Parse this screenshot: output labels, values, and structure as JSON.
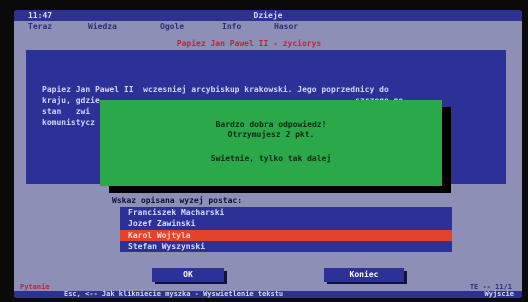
{
  "titlebar": {
    "time": "11:47",
    "title": "Dzieje"
  },
  "menu": [
    "Teraz",
    "Wiedza",
    "Ogole",
    "Info",
    "Hasor"
  ],
  "tab_title": "Papiez Jan Pawel II - zyciorys",
  "panel": {
    "lines": [
      "Papiez Jan Pawel II  wczesniej arcybiskup krakowski. Jego poprzednicy do",
      "kraju, gdzie                                                     szczego no",
      "stan   zwi                                                       wladzy",
      "komunistycz"
    ]
  },
  "dialog": {
    "line1": "Bardzo dobra odpowiedz!",
    "line2": "Otrzymujesz 2 pkt.",
    "line3": "Swietnie, tylko tak dalej"
  },
  "prompt": "Wskaz opisana wyzej postac:",
  "list": {
    "items": [
      "Franciszek Macharski",
      "Jozef Zawinski",
      "Karol Wojtyla",
      "Stefan Wyszynski"
    ],
    "selected_index": 2
  },
  "buttons": {
    "ok": "OK",
    "cancel": "Koniec"
  },
  "bottom_status": {
    "left": "Pytanie",
    "right": "TE -- 11/1"
  },
  "statusbar": {
    "help": "Esc, <-- Jak klikniecie myszka - Wyswietlenie tekstu",
    "right": "Wyjscie"
  },
  "colors": {
    "panel": "#2c3198",
    "dialog": "#2aa84a",
    "selected": "#e4432b",
    "background": "#8d8fb6"
  }
}
